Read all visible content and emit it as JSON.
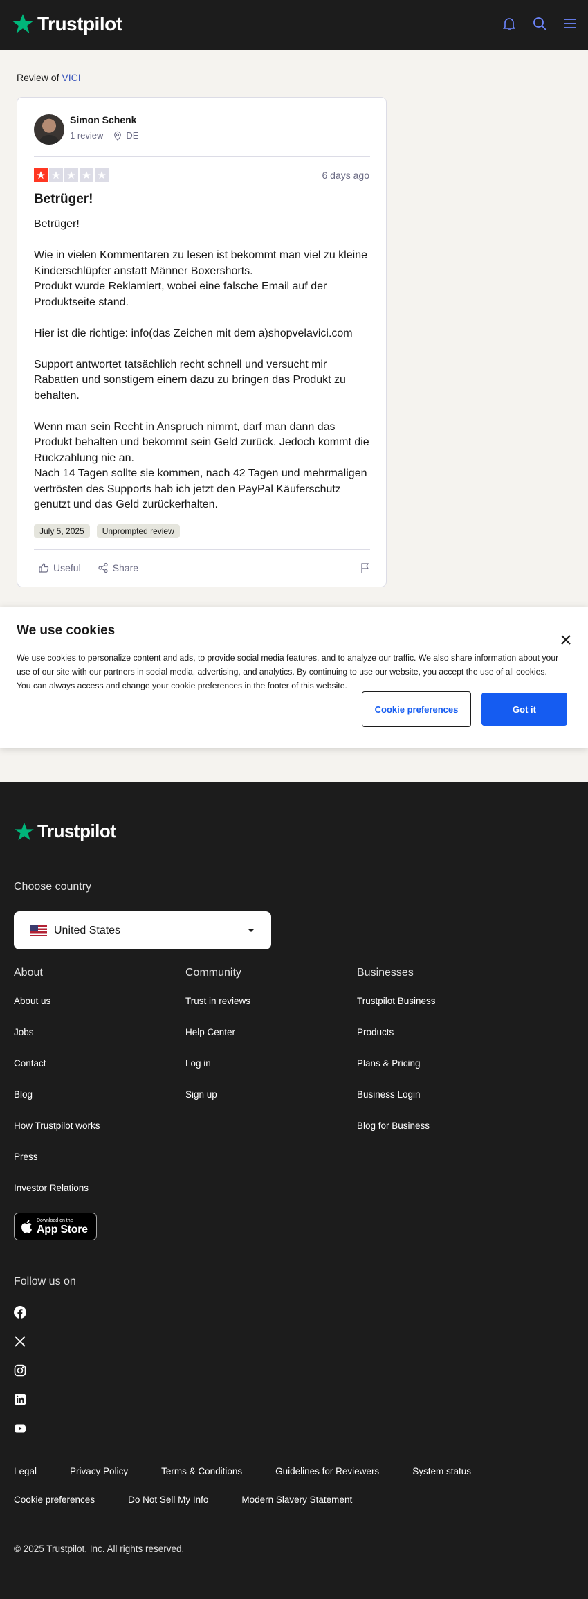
{
  "header": {
    "brand": "Trustpilot",
    "icons": [
      "bell-icon",
      "search-icon",
      "menu-icon"
    ]
  },
  "review_of": {
    "prefix": "Review of ",
    "company": "VICI"
  },
  "review": {
    "author": "Simon Schenk",
    "review_count": "1 review",
    "country": "DE",
    "rating": 1,
    "rating_max": 5,
    "date_ago": "6 days ago",
    "title": "Betrüger!",
    "body": [
      "Betrüger!",
      "",
      "Wie in vielen Kommentaren zu lesen ist bekommt man viel zu kleine Kinderschlüpfer anstatt Männer Boxershorts.",
      "Produkt wurde Reklamiert, wobei eine falsche Email auf der Produktseite stand.",
      "",
      "Hier ist die richtige: info(das Zeichen mit dem a)shopvelavici.com",
      "",
      "Support antwortet tatsächlich recht schnell und versucht mir Rabatten und sonstigem einem dazu zu bringen das Produkt zu behalten.",
      "",
      "Wenn man sein Recht in Anspruch nimmt, darf man dann das Produkt behalten und bekommt sein Geld zurück. Jedoch kommt die Rückzahlung nie an.",
      "Nach 14 Tagen sollte sie kommen, nach 42 Tagen und mehrmaligen vertrösten des Supports hab ich jetzt den PayPal Käuferschutz genutzt und das Geld zurückerhalten."
    ],
    "date_tag": "July 5, 2025",
    "type_tag": "Unprompted review",
    "useful_label": "Useful",
    "share_label": "Share"
  },
  "cookie": {
    "title": "We use cookies",
    "text": "We use cookies to personalize content and ads, to provide social media features, and to analyze our traffic. We also share information about your use of our site with our partners in social media, advertising, and analytics. By continuing to use our website, you accept the use of all cookies. You can always access and change your cookie preferences in the footer of this website.",
    "preferences_label": "Cookie preferences",
    "ok_label": "Got it"
  },
  "footer": {
    "brand": "Trustpilot",
    "choose_country": "Choose country",
    "country": "United States",
    "columns": [
      {
        "title": "About",
        "links": [
          "About us",
          "Jobs",
          "Contact",
          "Blog",
          "How Trustpilot works",
          "Press",
          "Investor Relations"
        ]
      },
      {
        "title": "Community",
        "links": [
          "Trust in reviews",
          "Help Center",
          "Log in",
          "Sign up"
        ]
      },
      {
        "title": "Businesses",
        "links": [
          "Trustpilot Business",
          "Products",
          "Plans & Pricing",
          "Business Login",
          "Blog for Business"
        ]
      }
    ],
    "app_store": {
      "small": "Download on the",
      "big": "App Store"
    },
    "follow_us": "Follow us on",
    "socials": [
      "facebook-icon",
      "x-icon",
      "instagram-icon",
      "linkedin-icon",
      "youtube-icon"
    ],
    "legal": [
      "Legal",
      "Privacy Policy",
      "Terms & Conditions",
      "Guidelines for Reviewers",
      "System status",
      "Cookie preferences",
      "Do Not Sell My Info",
      "Modern Slavery Statement"
    ],
    "copyright": "© 2025 Trustpilot, Inc. All rights reserved."
  },
  "colors": {
    "brand_green": "#00b67a",
    "star_red": "#ff3722",
    "primary_blue": "#155cf1",
    "dark_bg": "#1c1c1c",
    "page_bg": "#f5f3ef"
  }
}
